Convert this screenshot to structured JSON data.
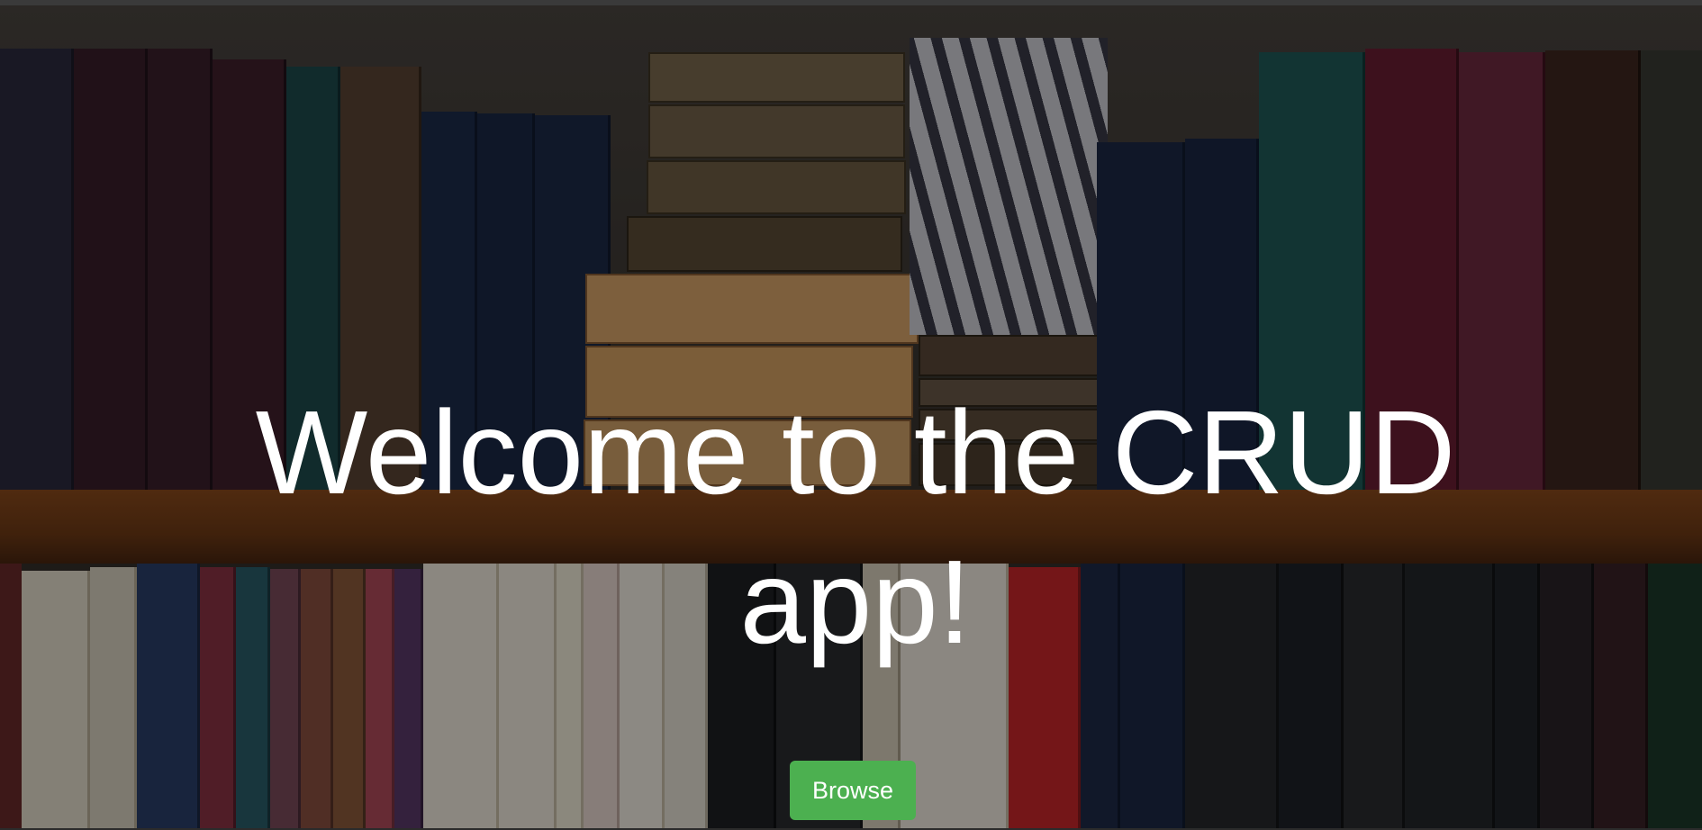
{
  "hero": {
    "title": "Welcome to the CRUD app!",
    "browse_label": "Browse",
    "button_color": "#4cb050"
  }
}
